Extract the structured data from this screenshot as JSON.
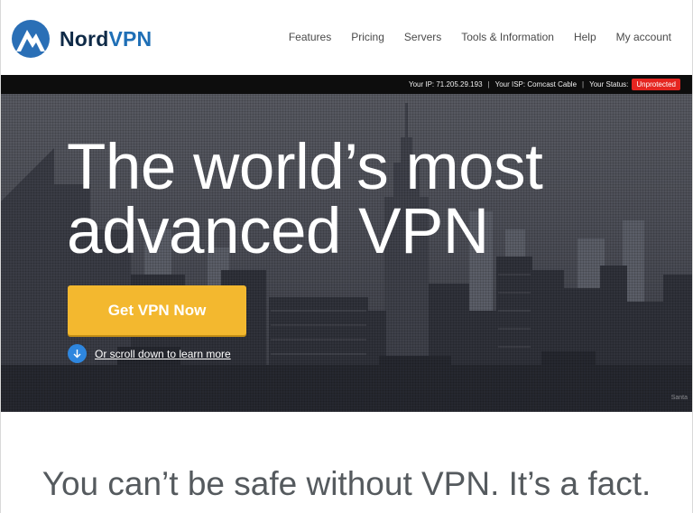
{
  "brand": {
    "name_part1": "Nord",
    "name_part2": "VPN",
    "logo_icon": "mountain-logo-icon",
    "colors": {
      "dark": "#0f2a47",
      "blue": "#1f6fb6"
    }
  },
  "nav": {
    "items": [
      {
        "label": "Features"
      },
      {
        "label": "Pricing"
      },
      {
        "label": "Servers"
      },
      {
        "label": "Tools & Information"
      },
      {
        "label": "Help"
      },
      {
        "label": "My account"
      }
    ]
  },
  "status_bar": {
    "ip": "Your IP: 71.205.29.193",
    "isp": "Your ISP: Comcast Cable",
    "status_label": "Your Status:",
    "status_value": "Unprotected",
    "separator": "|",
    "status_color": "#e52520"
  },
  "hero": {
    "headline_line1": "The world’s most",
    "headline_line2": "advanced VPN",
    "cta_label": "Get VPN Now",
    "cta_color": "#f3b82f",
    "scroll_label": "Or scroll down to learn more",
    "scroll_icon": "arrow-down-circle-icon",
    "image_credit": "Santa"
  },
  "tagline": "You can’t be safe without VPN. It’s a fact."
}
